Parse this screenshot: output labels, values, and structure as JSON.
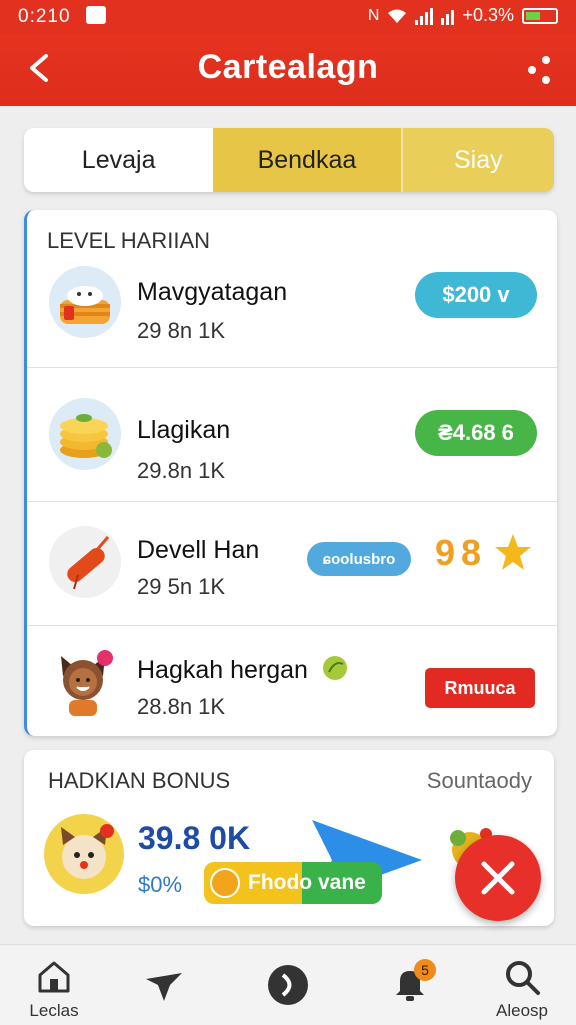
{
  "status": {
    "time": "0:210",
    "battery_text": "+0.3%"
  },
  "header": {
    "title": "Cartealagn"
  },
  "tabs": [
    "Levaja",
    "Bendkaa",
    "Siay"
  ],
  "levels": {
    "section_title": "LEVEL HARIIAN",
    "items": [
      {
        "name": "Mavgyatagan",
        "sub": "29 8n 1K",
        "badge": "$200 v",
        "badge_color": "#3fb8d6"
      },
      {
        "name": "Llagikan",
        "sub": "29.8n 1K",
        "badge": "₴4.68 6",
        "badge_color": "#48b548"
      },
      {
        "name": "Devell Han",
        "sub": "29 5n 1K",
        "badge": "ɕoolusbro",
        "badge_color": "#52a9de",
        "score": "98"
      },
      {
        "name": "Hagkah hergan",
        "sub": "28.8n 1K",
        "badge": "Rmuuca",
        "badge_color": "#e32a22"
      }
    ]
  },
  "bonus": {
    "section_title": "HADKIAN BONUS",
    "see_all": "Sountaody",
    "amount": "39.8 0K",
    "percent": "$0%",
    "cta": "Fhodo vane"
  },
  "nav": [
    {
      "label": "Leclas",
      "icon": "home-icon"
    },
    {
      "label": "",
      "icon": "hat-icon"
    },
    {
      "label": "",
      "icon": "play-icon"
    },
    {
      "label": "",
      "icon": "bell-icon",
      "badge": "5"
    },
    {
      "label": "Aleosp",
      "icon": "search-icon"
    }
  ],
  "colors": {
    "brand": "#e2321f",
    "tab_active": "#e7c546",
    "accent_blue": "#3a8fd8"
  }
}
